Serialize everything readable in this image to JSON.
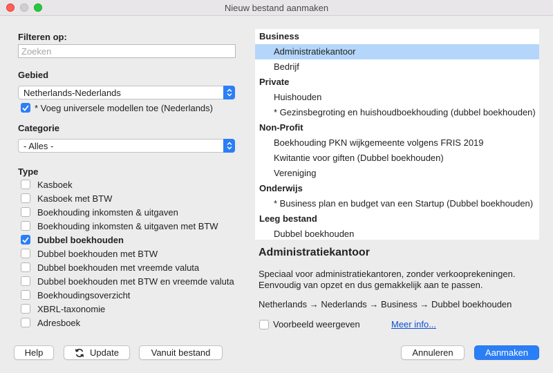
{
  "window": {
    "title": "Nieuw bestand aanmaken"
  },
  "filter": {
    "label": "Filteren op:",
    "placeholder": "Zoeken",
    "value": ""
  },
  "region": {
    "label": "Gebied",
    "selected": "Netherlands-Nederlands",
    "universal_label": "* Voeg universele modellen toe (Nederlands)",
    "universal_checked": true
  },
  "category": {
    "label": "Categorie",
    "selected": "- Alles -"
  },
  "type": {
    "label": "Type",
    "items": [
      {
        "label": "Kasboek",
        "checked": false
      },
      {
        "label": "Kasboek met BTW",
        "checked": false
      },
      {
        "label": "Boekhouding inkomsten & uitgaven",
        "checked": false
      },
      {
        "label": "Boekhouding inkomsten & uitgaven met BTW",
        "checked": false
      },
      {
        "label": "Dubbel boekhouden",
        "checked": true
      },
      {
        "label": "Dubbel boekhouden met BTW",
        "checked": false
      },
      {
        "label": "Dubbel boekhouden met vreemde valuta",
        "checked": false
      },
      {
        "label": "Dubbel boekhouden met BTW en vreemde valuta",
        "checked": false
      },
      {
        "label": "Boekhoudingsoverzicht",
        "checked": false
      },
      {
        "label": "XBRL-taxonomie",
        "checked": false
      },
      {
        "label": "Adresboek",
        "checked": false
      }
    ]
  },
  "templates": [
    {
      "label": "Business",
      "group": true
    },
    {
      "label": "Administratiekantoor",
      "group": false,
      "selected": true
    },
    {
      "label": "Bedrijf",
      "group": false
    },
    {
      "label": "Private",
      "group": true
    },
    {
      "label": "Huishouden",
      "group": false
    },
    {
      "label": "* Gezinsbegroting en huishoudboekhouding (dubbel boekhouden)",
      "group": false
    },
    {
      "label": "Non-Profit",
      "group": true
    },
    {
      "label": "Boekhouding PKN wijkgemeente volgens FRIS 2019",
      "group": false
    },
    {
      "label": "Kwitantie voor giften (Dubbel boekhouden)",
      "group": false
    },
    {
      "label": "Vereniging",
      "group": false
    },
    {
      "label": "Onderwijs",
      "group": true
    },
    {
      "label": "* Business plan en budget van een Startup (Dubbel boekhouden)",
      "group": false
    },
    {
      "label": "Leeg bestand",
      "group": true
    },
    {
      "label": "Dubbel boekhouden",
      "group": false
    }
  ],
  "detail": {
    "title": "Administratiekantoor",
    "description_line1": "Speciaal voor administratiekantoren, zonder verkooprekeningen.",
    "description_line2": "Eenvoudig van opzet en dus gemakkelijk aan te passen.",
    "path": "Netherlands → Nederlands → Business → Dubbel boekhouden",
    "preview_label": "Voorbeeld weergeven",
    "preview_checked": false,
    "more_info": "Meer info..."
  },
  "buttons": {
    "help": "Help",
    "update": "Update",
    "from_file": "Vanuit bestand",
    "cancel": "Annuleren",
    "create": "Aanmaken"
  },
  "colors": {
    "accent": "#2b7ff6",
    "selection": "#b4d6fb",
    "link": "#0b4fd3"
  }
}
